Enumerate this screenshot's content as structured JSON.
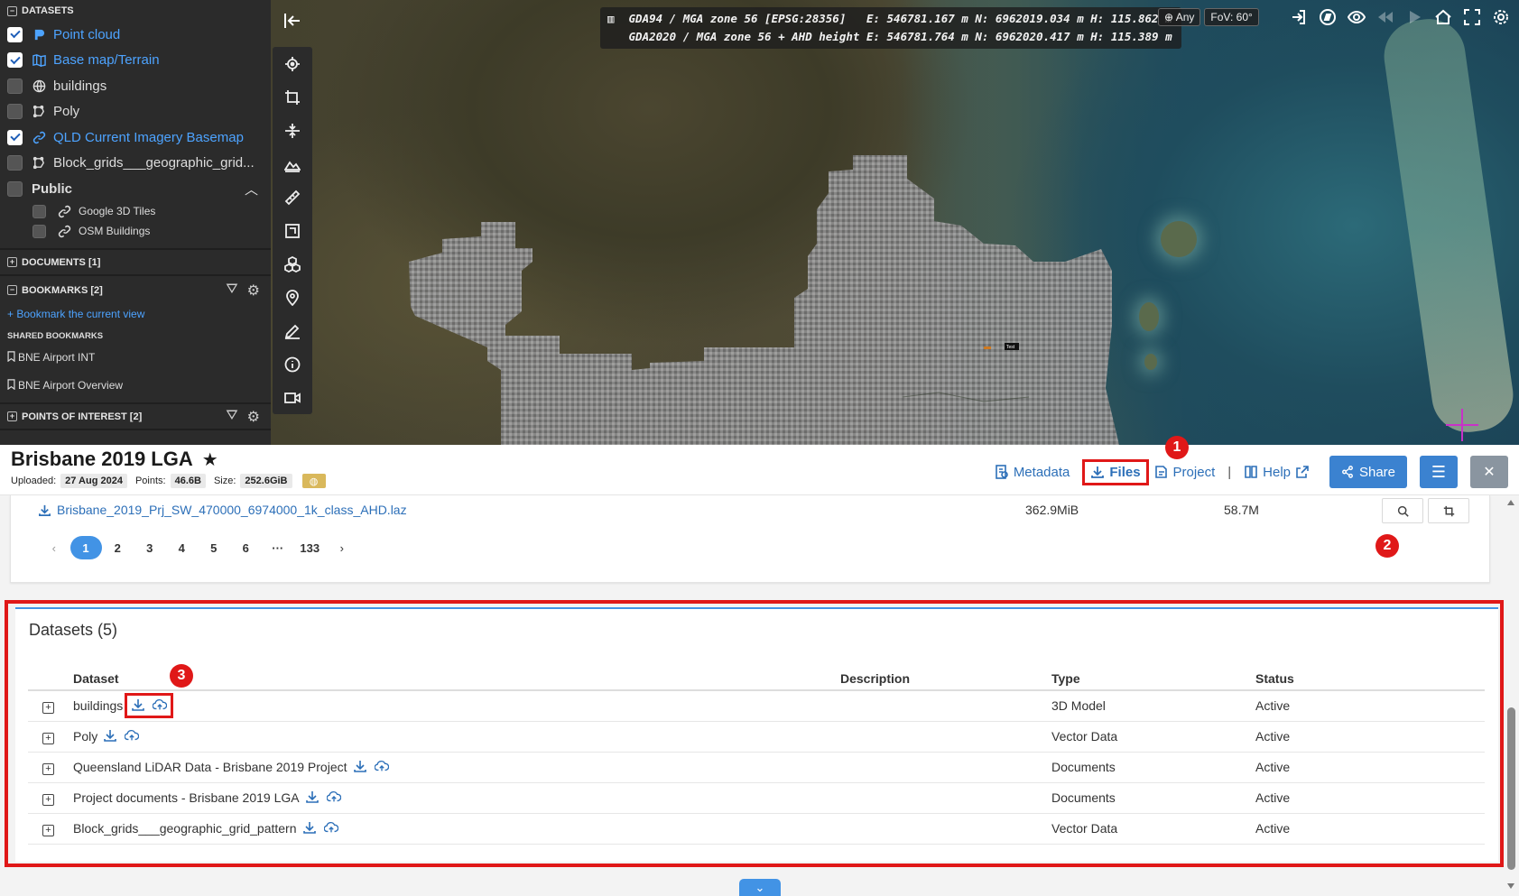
{
  "left_panel": {
    "datasets_header": "DATASETS",
    "layers": [
      {
        "label": "Point cloud",
        "checked": true,
        "icon": "point-cloud-icon"
      },
      {
        "label": "Base map/Terrain",
        "checked": true,
        "icon": "map-icon"
      },
      {
        "label": "buildings",
        "checked": false,
        "icon": "globe-icon"
      },
      {
        "label": "Poly",
        "checked": false,
        "icon": "polygon-icon"
      },
      {
        "label": "QLD Current Imagery Basemap",
        "checked": true,
        "icon": "link-icon"
      },
      {
        "label": "Block_grids___geographic_grid...",
        "checked": false,
        "icon": "polygon-icon"
      }
    ],
    "public_label": "Public",
    "public_items": [
      {
        "label": "Google 3D Tiles",
        "checked": false,
        "icon": "link-icon"
      },
      {
        "label": "OSM Buildings",
        "checked": false,
        "icon": "link-icon"
      }
    ],
    "documents_header": "DOCUMENTS [1]",
    "bookmarks_header": "BOOKMARKS [2]",
    "bookmark_current_view": "+ Bookmark the current view",
    "shared_bookmarks_header": "SHARED BOOKMARKS",
    "bookmarks": [
      "BNE Airport INT",
      "BNE Airport Overview"
    ],
    "poi_header": "POINTS OF INTEREST [2]"
  },
  "coords": {
    "line1_crs": "GDA94 / MGA zone 56 [EPSG:28356]",
    "line1_values": "E: 546781.167 m N: 6962019.034 m H: 115.862 m",
    "line2_crs": "GDA2020 / MGA zone 56 + AHD height",
    "line2_values": "E: 546781.764 m N: 6962020.417 m H: 115.389 m",
    "mode": "Any",
    "fov": "FoV: 60°"
  },
  "map_label": "Test",
  "dataset": {
    "title": "Brisbane 2019 LGA",
    "uploaded_label": "Uploaded:",
    "uploaded": "27 Aug 2024",
    "points_label": "Points:",
    "points": "46.6B",
    "size_label": "Size:",
    "size": "252.6GiB"
  },
  "actions": {
    "metadata": "Metadata",
    "files": "Files",
    "project": "Project",
    "separator": "|",
    "help": "Help",
    "share": "Share"
  },
  "markers": [
    "1",
    "2",
    "3"
  ],
  "files": {
    "row": {
      "name": "Brisbane_2019_Prj_SW_470000_6974000_1k_class_AHD.laz",
      "size": "362.9MiB",
      "points": "58.7M"
    },
    "pages": [
      "1",
      "2",
      "3",
      "4",
      "5",
      "6",
      "···",
      "133"
    ],
    "current_page": "1"
  },
  "datasets_panel": {
    "title": "Datasets (5)",
    "columns": [
      "Dataset",
      "Description",
      "Type",
      "Status"
    ],
    "rows": [
      {
        "name": "buildings",
        "description": "",
        "type": "3D Model",
        "status": "Active"
      },
      {
        "name": "Poly",
        "description": "",
        "type": "Vector Data",
        "status": "Active"
      },
      {
        "name": "Queensland LiDAR Data - Brisbane 2019 Project",
        "description": "",
        "type": "Documents",
        "status": "Active"
      },
      {
        "name": "Project documents - Brisbane 2019 LGA",
        "description": "",
        "type": "Documents",
        "status": "Active"
      },
      {
        "name": "Block_grids___geographic_grid_pattern",
        "description": "",
        "type": "Vector Data",
        "status": "Active"
      }
    ]
  },
  "colors": {
    "accent": "#3b82d0",
    "link": "#2c6fb8",
    "highlight": "#e01818",
    "panel_dark": "#2b2b2b"
  }
}
